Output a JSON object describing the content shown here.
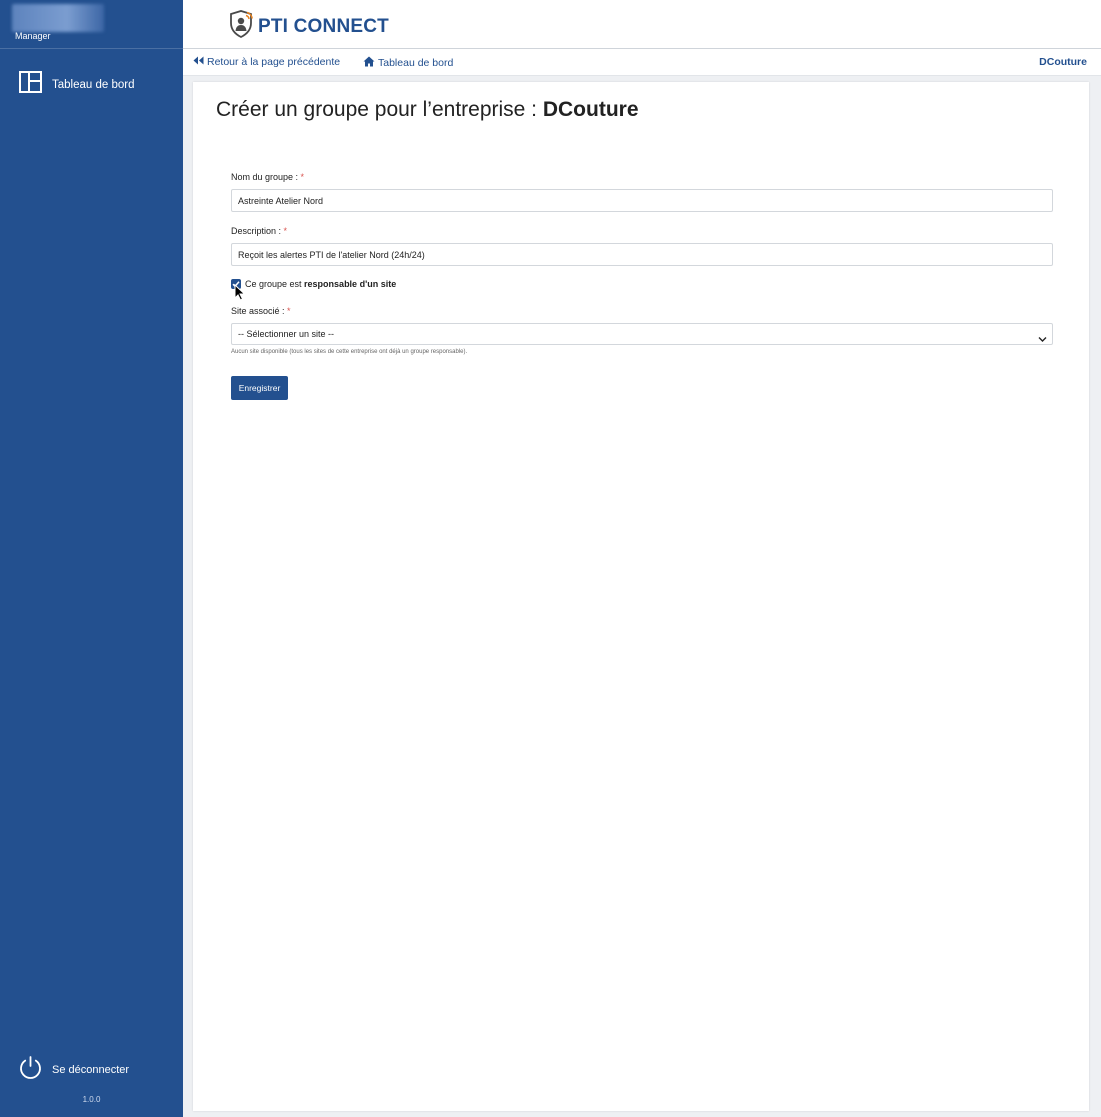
{
  "sidebar": {
    "role": "Manager",
    "nav_dashboard": "Tableau de bord",
    "logout": "Se déconnecter",
    "version": "1.0.0"
  },
  "header": {
    "app_name": "PTI CONNECT"
  },
  "breadcrumb": {
    "back": "Retour à la page précédente",
    "home": "Tableau de bord",
    "company": "DCouture"
  },
  "page": {
    "title_prefix": "Créer un groupe pour l’entreprise : ",
    "company": "DCouture"
  },
  "form": {
    "name_label": "Nom du groupe : ",
    "name_value": "Astreinte Atelier Nord",
    "description_label": "Description : ",
    "description_value": "Reçoit les alertes PTI de l'atelier Nord (24h/24)",
    "required_mark": "*",
    "responsible_prefix": "Ce groupe est ",
    "responsible_bold": "responsable d'un site",
    "responsible_checked": true,
    "site_label": "Site associé : ",
    "site_selected": "-- Sélectionner un site --",
    "site_help": "Aucun site disponible (tous les sites de cette entreprise ont déjà un groupe responsable).",
    "submit": "Enregistrer"
  },
  "colors": {
    "primary": "#23508f",
    "required": "#d9534f",
    "content_bg": "#eef0f3"
  },
  "icons": {
    "dashboard": "layout-grid-icon",
    "logout": "power-icon",
    "back": "double-chevron-left-icon",
    "home": "home-icon",
    "logo": "shield-person-signal-icon"
  }
}
